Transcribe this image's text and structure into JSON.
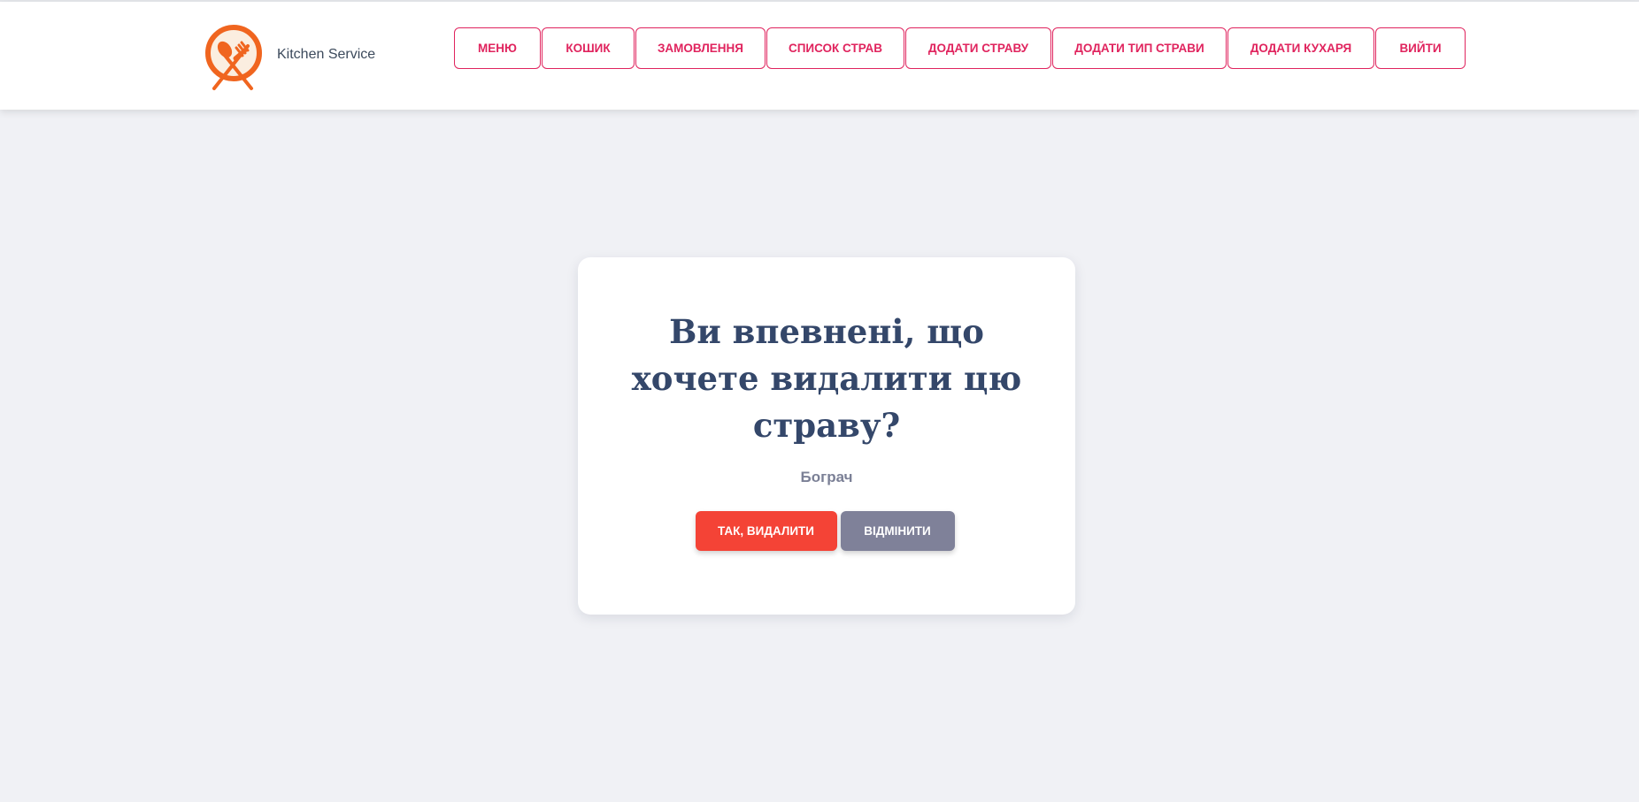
{
  "brand": {
    "name": "Kitchen Service",
    "logo_icon": "plate-spoon-fork-icon"
  },
  "nav": {
    "items": [
      {
        "label": "МЕНЮ"
      },
      {
        "label": "КОШИК"
      },
      {
        "label": "ЗАМОВЛЕННЯ"
      },
      {
        "label": "СПИСОК СТРАВ"
      },
      {
        "label": "ДОДАТИ СТРАВУ"
      },
      {
        "label": "ДОДАТИ ТИП СТРАВИ"
      },
      {
        "label": "ДОДАТИ КУХАРЯ"
      },
      {
        "label": "ВИЙТИ"
      }
    ]
  },
  "dialog": {
    "title": "Ви впевнені, що хочете видалити цю страву?",
    "dish_name": "Бограч",
    "confirm_label": "ТАК, ВИДАЛИТИ",
    "cancel_label": "ВІДМІНИТИ"
  },
  "colors": {
    "accent": "#e0245e",
    "danger": "#f44336",
    "neutral": "#7f8199",
    "title": "#34476a",
    "logo_orange": "#f0651f",
    "background": "#f0f1f5"
  }
}
